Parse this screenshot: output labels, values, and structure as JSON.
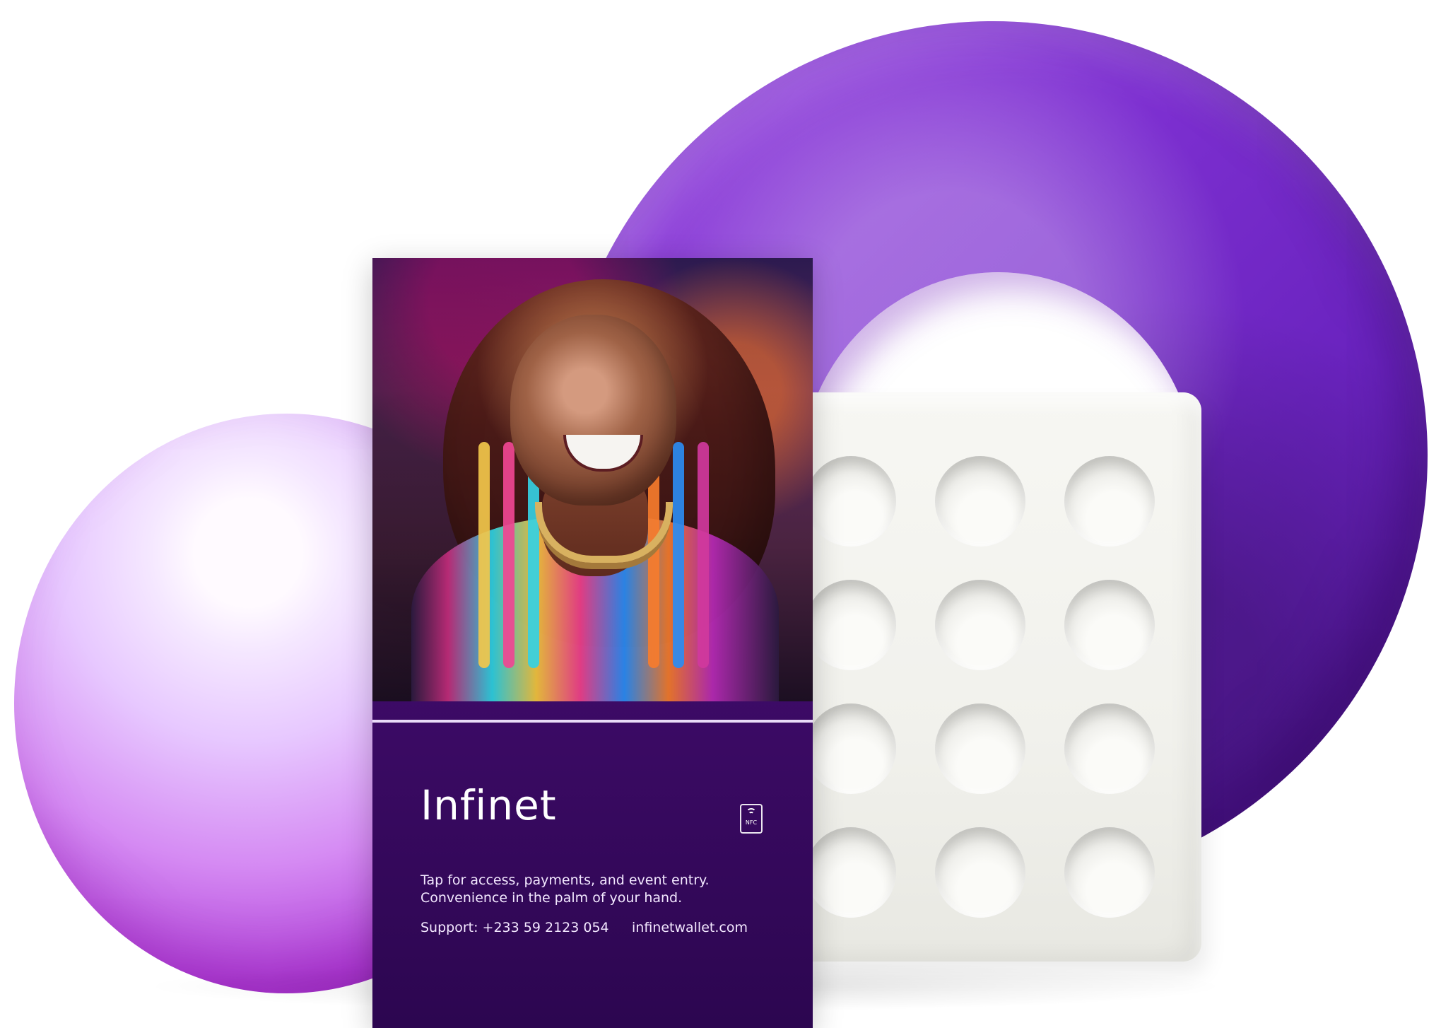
{
  "card": {
    "brand": "Infinet",
    "nfc_label": "NFC",
    "tagline": [
      "Tap for access, payments, and event entry.",
      "Convenience in the palm of your hand."
    ],
    "support": "Support: +233 59 2123 054",
    "website": "infinetwallet.com"
  },
  "colors": {
    "card": "#3d0b67",
    "torus": "#7c2fd0",
    "sphere": "#d58af3",
    "block": "#f1f1ec"
  },
  "icons": {
    "nfc": "nfc-icon"
  }
}
